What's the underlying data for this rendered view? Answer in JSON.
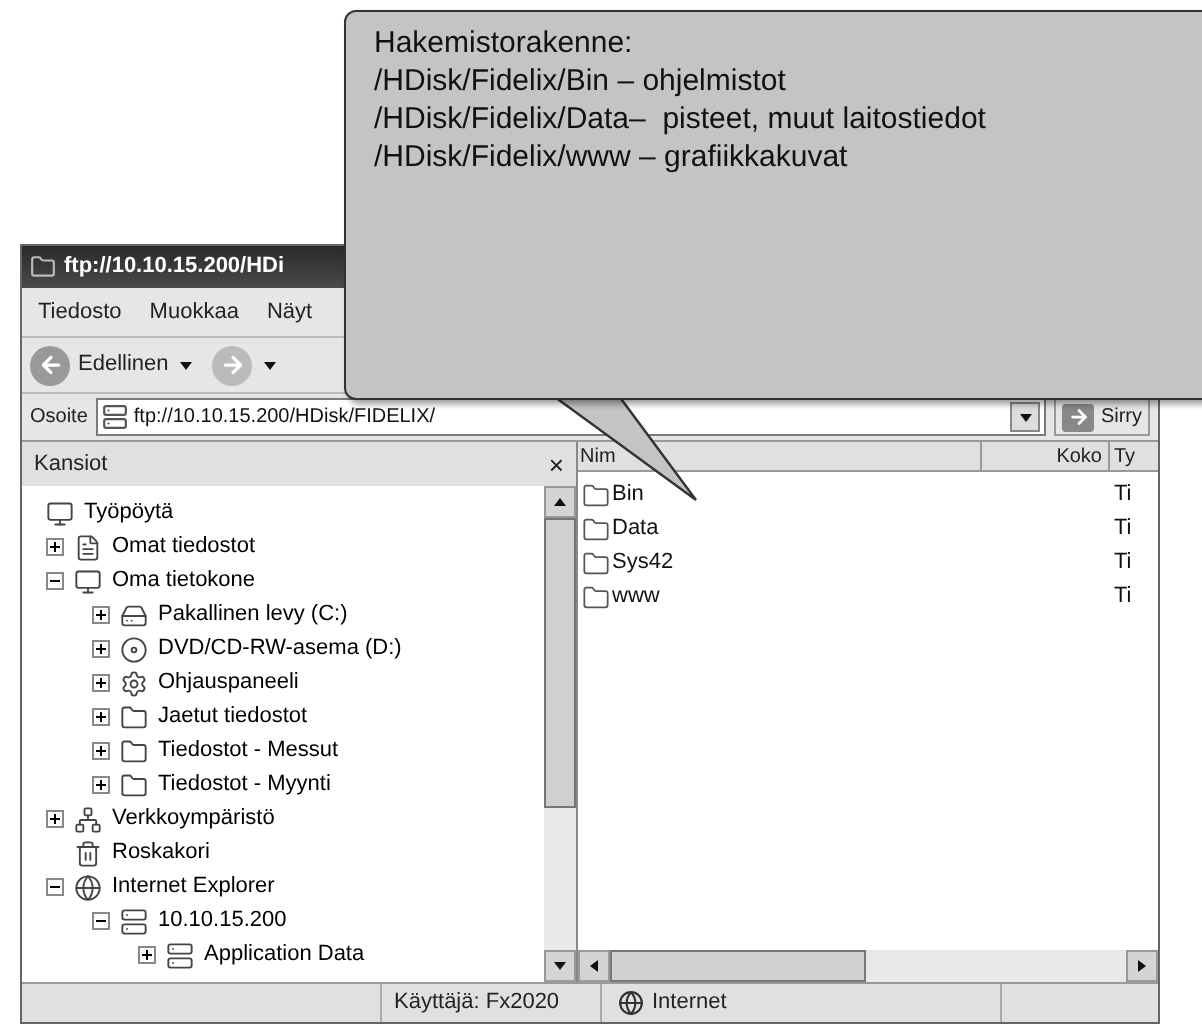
{
  "window": {
    "title": "ftp://10.10.15.200/HDi"
  },
  "menu": [
    "Tiedosto",
    "Muokkaa",
    "Näyt"
  ],
  "toolbar": {
    "back_label": "Edellinen"
  },
  "address_bar": {
    "label": "Osoite",
    "value": "ftp://10.10.15.200/HDisk/FIDELIX/",
    "go_label": "Sirry"
  },
  "folders_pane": {
    "title": "Kansiot",
    "close": "×",
    "tree": [
      {
        "label": "Työpöytä",
        "kind": "desktop",
        "children": [
          {
            "label": "Omat tiedostot",
            "kind": "documents",
            "expanded": false
          },
          {
            "label": "Oma tietokone",
            "kind": "computer",
            "expanded": true,
            "children": [
              {
                "label": "Pakallinen levy (C:)",
                "kind": "drive",
                "expanded": false
              },
              {
                "label": "DVD/CD-RW-asema (D:)",
                "kind": "cdrom",
                "expanded": false
              },
              {
                "label": "Ohjauspaneeli",
                "kind": "control-panel",
                "expanded": false
              },
              {
                "label": "Jaetut tiedostot",
                "kind": "folder",
                "expanded": false
              },
              {
                "label": "Tiedostot - Messut",
                "kind": "folder",
                "expanded": false
              },
              {
                "label": "Tiedostot - Myynti",
                "kind": "folder",
                "expanded": false
              }
            ]
          },
          {
            "label": "Verkkoympäristö",
            "kind": "network",
            "expanded": false
          },
          {
            "label": "Roskakori",
            "kind": "recycle-bin"
          },
          {
            "label": "Internet Explorer",
            "kind": "browser",
            "expanded": true,
            "children": [
              {
                "label": "10.10.15.200",
                "kind": "server",
                "expanded": true,
                "children": [
                  {
                    "label": "Application Data",
                    "kind": "server",
                    "expanded": false
                  }
                ]
              }
            ]
          }
        ]
      }
    ]
  },
  "file_list": {
    "columns": [
      "Nim",
      "Koko",
      "Ty"
    ],
    "rows": [
      {
        "name": "Bin",
        "type": "Ti"
      },
      {
        "name": "Data",
        "type": "Ti"
      },
      {
        "name": "Sys42",
        "type": "Ti"
      },
      {
        "name": "www",
        "type": "Ti"
      }
    ]
  },
  "status_bar": [
    {
      "kind": "text",
      "text": "Käyttäjä: Fx2020"
    },
    {
      "kind": "zone",
      "text": "Internet"
    }
  ],
  "callout": {
    "lines": [
      "Hakemistorakenne:",
      "/HDisk/Fidelix/Bin – ohjelmistot",
      "/HDisk/Fidelix/Data–  pisteet, muut laitostiedot",
      "/HDisk/Fidelix/www – grafiikkakuvat"
    ]
  }
}
